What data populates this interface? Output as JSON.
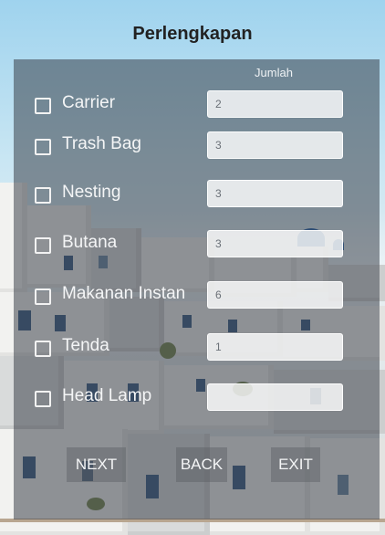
{
  "header": {
    "title": "Perlengkapan"
  },
  "table": {
    "qty_header": "Jumlah"
  },
  "items": [
    {
      "label": "Carrier",
      "qty": "2",
      "checked": false
    },
    {
      "label": "Trash Bag",
      "qty": "3",
      "checked": false
    },
    {
      "label": "Nesting",
      "qty": "3",
      "checked": false
    },
    {
      "label": "Butana",
      "qty": "3",
      "checked": false
    },
    {
      "label": "Makanan Instan",
      "qty": "6",
      "checked": false
    },
    {
      "label": "Tenda",
      "qty": "1",
      "checked": false
    },
    {
      "label": "Head Lamp",
      "qty": "",
      "checked": false
    }
  ],
  "buttons": {
    "next": "NEXT",
    "back": "BACK",
    "exit": "EXIT"
  }
}
